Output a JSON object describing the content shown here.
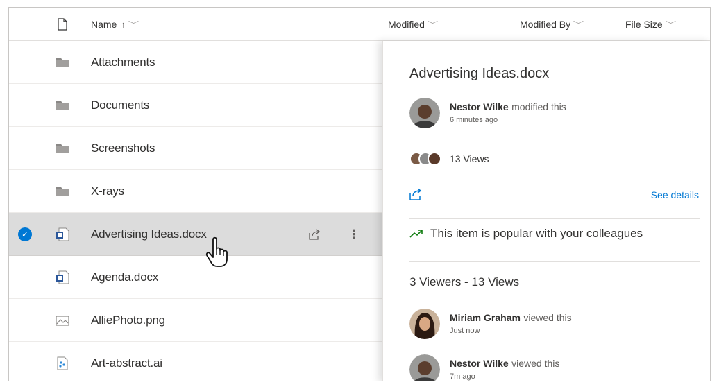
{
  "columns": {
    "name": "Name",
    "name_sort": "↑",
    "modified": "Modified",
    "modified_by": "Modified By",
    "file_size": "File Size"
  },
  "files": [
    {
      "name": "Attachments",
      "type": "folder"
    },
    {
      "name": "Documents",
      "type": "folder"
    },
    {
      "name": "Screenshots",
      "type": "folder"
    },
    {
      "name": "X-rays",
      "type": "folder"
    },
    {
      "name": "Advertising Ideas.docx",
      "type": "word",
      "selected": true
    },
    {
      "name": "Agenda.docx",
      "type": "word"
    },
    {
      "name": "AlliePhoto.png",
      "type": "image"
    },
    {
      "name": "Art-abstract.ai",
      "type": "illustrator"
    }
  ],
  "row_actions": {
    "share_icon": "share-icon",
    "more_icon": "more-vertical-icon",
    "more_glyph": "⋮"
  },
  "details": {
    "title": "Advertising Ideas.docx",
    "last_activity": {
      "who": "Nestor Wilke",
      "what": "modified this",
      "when": "6 minutes ago"
    },
    "views_label": "13 Views",
    "see_details": "See details",
    "popular": "This item is popular with your colleagues",
    "viewers_summary": "3 Viewers - 13 Views",
    "viewers": [
      {
        "who": "Miriam Graham",
        "what": "viewed this",
        "when": "Just now"
      },
      {
        "who": "Nestor Wilke",
        "what": "viewed this",
        "when": "7m ago"
      }
    ]
  },
  "colors": {
    "accent": "#0078d4",
    "selected_row": "#dcdcdc",
    "trend": "#107c10"
  }
}
